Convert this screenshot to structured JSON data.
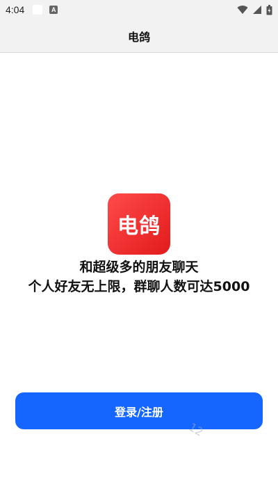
{
  "status_bar": {
    "time": "4:04",
    "notification_icon": "A",
    "icons": [
      "wifi-icon",
      "signal-icon",
      "battery-icon"
    ]
  },
  "header": {
    "title": "电鸽"
  },
  "logo": {
    "text": "电鸽",
    "color_start": "#ff4a4a",
    "color_end": "#e21b1b"
  },
  "tagline": {
    "line1": "和超级多的朋友聊天",
    "line2": "个人好友无上限，群聊人数可达5000"
  },
  "login_button": {
    "label": "登录/注册",
    "color": "#1565ff"
  },
  "watermark": {
    "text": "12"
  }
}
